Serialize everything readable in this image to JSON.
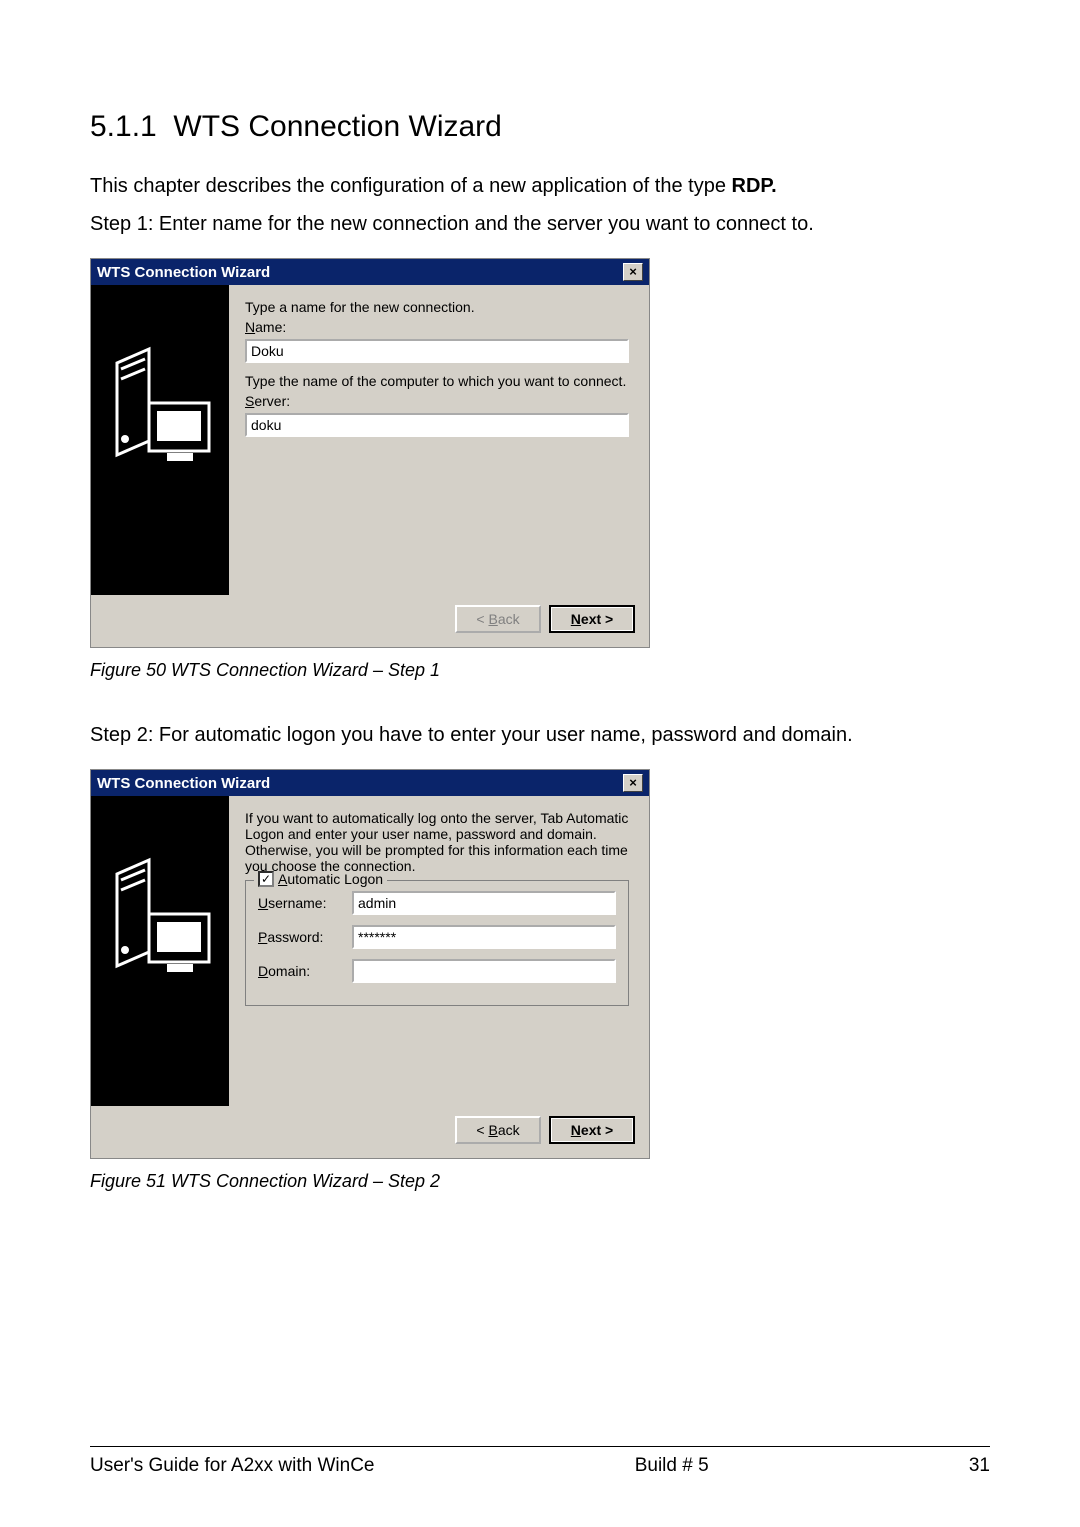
{
  "section": {
    "number": "5.1.1",
    "title": "WTS Connection Wizard"
  },
  "intro": {
    "line1_prefix": "This chapter describes the configuration of a new application of the type ",
    "line1_bold": "RDP.",
    "line2": "Step 1: Enter name for the new connection and the server you want to connect to."
  },
  "wizard1": {
    "title": "WTS Connection Wizard",
    "close_glyph": "×",
    "text1": "Type a name for the new connection.",
    "name_label": "Name:",
    "name_value": "Doku",
    "text2": "Type the name of the computer to which you want to connect.",
    "server_label": "Server:",
    "server_value": "doku",
    "back_prefix": "< ",
    "back_letter": "B",
    "back_rest": "ack",
    "next_letter": "N",
    "next_rest": "ext >"
  },
  "caption1": "Figure 50 WTS Connection Wizard – Step 1",
  "step2_text": "Step 2: For automatic logon you have to enter your user name, password and domain.",
  "wizard2": {
    "title": "WTS Connection Wizard",
    "close_glyph": "×",
    "intro_text": "If you want to automatically log onto the server, Tab Automatic Logon and enter your user name, password and domain. Otherwise, you will be prompted for this information each time you choose the connection.",
    "checkbox_checked_glyph": "✓",
    "auto_logon_letter": "A",
    "auto_logon_rest": "utomatic Logon",
    "username_letter": "U",
    "username_rest": "sername:",
    "username_value": "admin",
    "password_letter": "P",
    "password_rest": "assword:",
    "password_value": "*******",
    "domain_letter": "D",
    "domain_rest": "omain:",
    "domain_value": "",
    "back_prefix": "< ",
    "back_letter": "B",
    "back_rest": "ack",
    "next_letter": "N",
    "next_rest": "ext >"
  },
  "caption2": "Figure 51 WTS Connection Wizard – Step 2",
  "footer": {
    "left": "User's Guide for A2xx with WinCe",
    "center": "Build # 5",
    "right": "31"
  }
}
